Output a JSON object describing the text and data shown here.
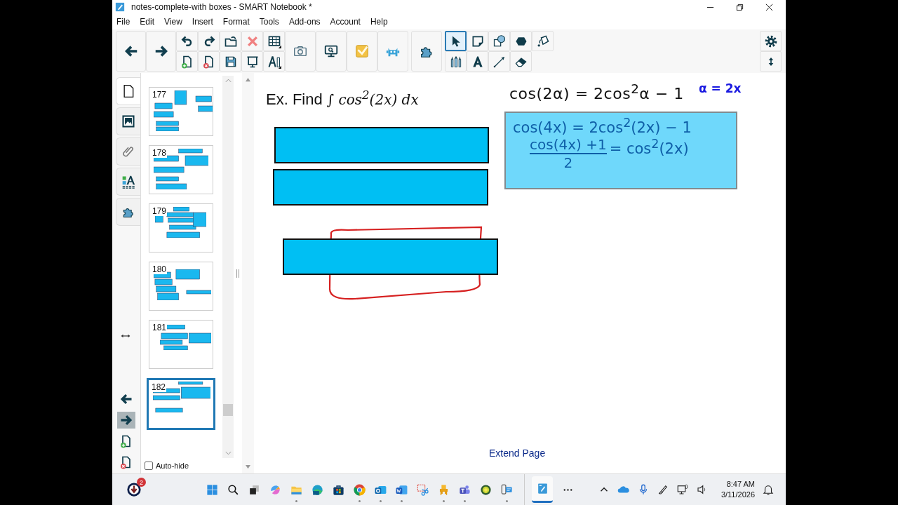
{
  "window": {
    "title": "notes-complete-with boxes - SMART Notebook *"
  },
  "menu": [
    "File",
    "Edit",
    "View",
    "Insert",
    "Format",
    "Tools",
    "Add-ons",
    "Account",
    "Help"
  ],
  "tools": [
    {
      "kind": "select",
      "selected": true
    },
    {
      "kind": "note",
      "selected": false
    },
    {
      "kind": "shapes",
      "selected": false
    },
    {
      "kind": "polygon",
      "selected": false
    },
    {
      "kind": "fill",
      "selected": false
    },
    {
      "kind": "pens",
      "selected": false
    },
    {
      "kind": "text",
      "selected": false
    },
    {
      "kind": "line",
      "selected": false
    },
    {
      "kind": "eraser",
      "selected": false
    }
  ],
  "side_tabs": [
    {
      "kind": "page",
      "selected": true
    },
    {
      "kind": "gallery",
      "selected": false
    },
    {
      "kind": "attachment",
      "selected": false
    },
    {
      "kind": "properties",
      "selected": false
    },
    {
      "kind": "addons",
      "selected": false
    }
  ],
  "pages": [
    {
      "number": "177",
      "selected": false
    },
    {
      "number": "178",
      "selected": false
    },
    {
      "number": "179",
      "selected": false
    },
    {
      "number": "180",
      "selected": false
    },
    {
      "number": "181",
      "selected": false
    },
    {
      "number": "182",
      "selected": true
    }
  ],
  "auto_hide": {
    "label": "Auto-hide",
    "checked": false
  },
  "canvas": {
    "heading": "Ex. Find",
    "integral": "∫ cos$^{2}$(2x) dx",
    "ink_identity": "cos(2α) = 2cos$^{2}$α − 1",
    "ink_substitution": "α = 2x",
    "note_line": "cos(4x) = 2cos$^{2}$(2x) − 1",
    "note_numerator": "cos(4x) +1",
    "note_denominator": "2",
    "note_rhs": "= cos$^{2}$(2x)",
    "extend_page": "Extend Page"
  },
  "taskbar": {
    "badge": "2",
    "apps": [
      {
        "kind": "start",
        "running": false
      },
      {
        "kind": "search",
        "running": false
      },
      {
        "kind": "taskview",
        "running": false
      },
      {
        "kind": "swirl",
        "running": false
      },
      {
        "kind": "folder",
        "running": true
      },
      {
        "kind": "wave",
        "running": false
      },
      {
        "kind": "store",
        "running": false
      },
      {
        "kind": "round",
        "running": true
      },
      {
        "kind": "mail",
        "running": true
      },
      {
        "kind": "word",
        "running": true
      },
      {
        "kind": "scissors",
        "running": false
      },
      {
        "kind": "chair",
        "running": true
      },
      {
        "kind": "people",
        "running": true
      },
      {
        "kind": "circle",
        "running": false
      },
      {
        "kind": "phone",
        "running": true
      }
    ],
    "time": "8:47 AM",
    "date": "3/11/2026"
  }
}
